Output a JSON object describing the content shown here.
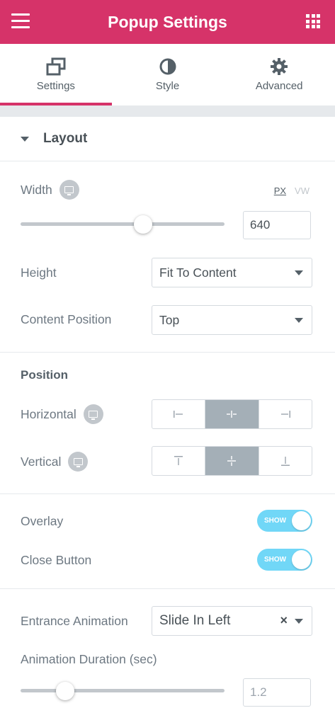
{
  "header": {
    "title": "Popup Settings",
    "menu_icon": "hamburger-icon",
    "apps_icon": "grid-icon"
  },
  "tabs": [
    {
      "label": "Settings",
      "icon": "settings-windows-icon",
      "active": true
    },
    {
      "label": "Style",
      "icon": "half-circle-icon",
      "active": false
    },
    {
      "label": "Advanced",
      "icon": "gear-icon",
      "active": false
    }
  ],
  "layout": {
    "section_title": "Layout",
    "width": {
      "label": "Width",
      "unit_px": "PX",
      "unit_vw": "VW",
      "value": "640",
      "slider_fraction": 0.6
    },
    "height": {
      "label": "Height",
      "value": "Fit To Content"
    },
    "content_position": {
      "label": "Content Position",
      "value": "Top"
    },
    "position_heading": "Position",
    "horizontal": {
      "label": "Horizontal",
      "options": [
        "left",
        "center",
        "right"
      ],
      "selected": "center"
    },
    "vertical": {
      "label": "Vertical",
      "options": [
        "top",
        "middle",
        "bottom"
      ],
      "selected": "middle"
    },
    "overlay": {
      "label": "Overlay",
      "toggle_text": "SHOW",
      "on": true
    },
    "close_button": {
      "label": "Close Button",
      "toggle_text": "SHOW",
      "on": true
    },
    "entrance_animation": {
      "label": "Entrance Animation",
      "value": "Slide In Left"
    },
    "animation_duration": {
      "label": "Animation Duration (sec)",
      "value": "1.2",
      "slider_fraction": 0.22
    }
  },
  "colors": {
    "brand": "#d63369",
    "toggle_on": "#71d7f7",
    "selected_choice": "#a4afb7"
  }
}
